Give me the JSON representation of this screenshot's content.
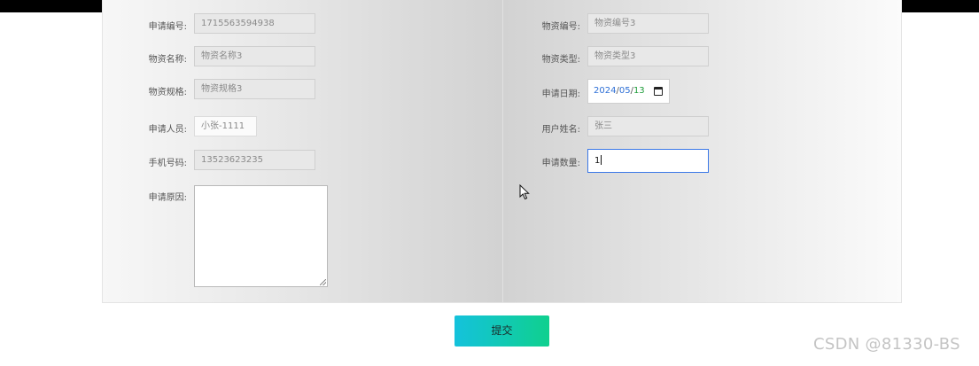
{
  "form": {
    "application_no": {
      "label": "申请编号:",
      "value": "1715563594938"
    },
    "material_no": {
      "label": "物资编号:",
      "placeholder": "物资编号3"
    },
    "material_name": {
      "label": "物资名称:",
      "placeholder": "物资名称3"
    },
    "material_type": {
      "label": "物资类型:",
      "placeholder": "物资类型3"
    },
    "material_spec": {
      "label": "物资规格:",
      "placeholder": "物资规格3"
    },
    "apply_date": {
      "label": "申请日期:",
      "year": "2024",
      "month": "05",
      "day": "13",
      "sep": "/"
    },
    "applicant": {
      "label": "申请人员:",
      "value": "小张-1111"
    },
    "user_name": {
      "label": "用户姓名:",
      "value": "张三"
    },
    "phone": {
      "label": "手机号码:",
      "value": "13523623235"
    },
    "quantity": {
      "label": "申请数量:",
      "value": "1"
    },
    "reason": {
      "label": "申请原因:",
      "value": ""
    }
  },
  "submit_label": "提交",
  "watermark": "CSDN @81330-BS",
  "icons": {
    "date_picker": "calendar-icon",
    "mouse": "mouse-pointer-icon"
  },
  "colors": {
    "submit_gradient_start": "#14c2dc",
    "submit_gradient_end": "#0fd08e",
    "focus_border": "#3b78e7"
  }
}
